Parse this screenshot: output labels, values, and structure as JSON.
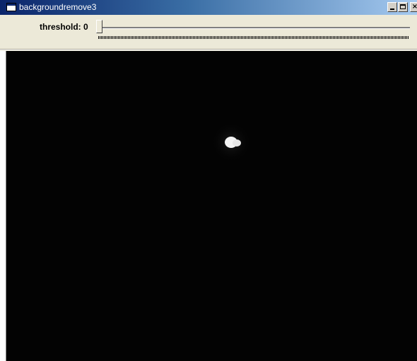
{
  "window": {
    "title": "backgroundremove3",
    "controls": {
      "minimize": "minimize",
      "maximize": "maximize",
      "close": "×"
    }
  },
  "trackbar": {
    "label": "threshold: 0",
    "value": 0
  },
  "image": {
    "background_color": "#030303",
    "blob_color": "#f4f4f4"
  },
  "colors": {
    "titlebar_start": "#0a246a",
    "titlebar_end": "#a6caf0",
    "window_face": "#ece9d8"
  }
}
